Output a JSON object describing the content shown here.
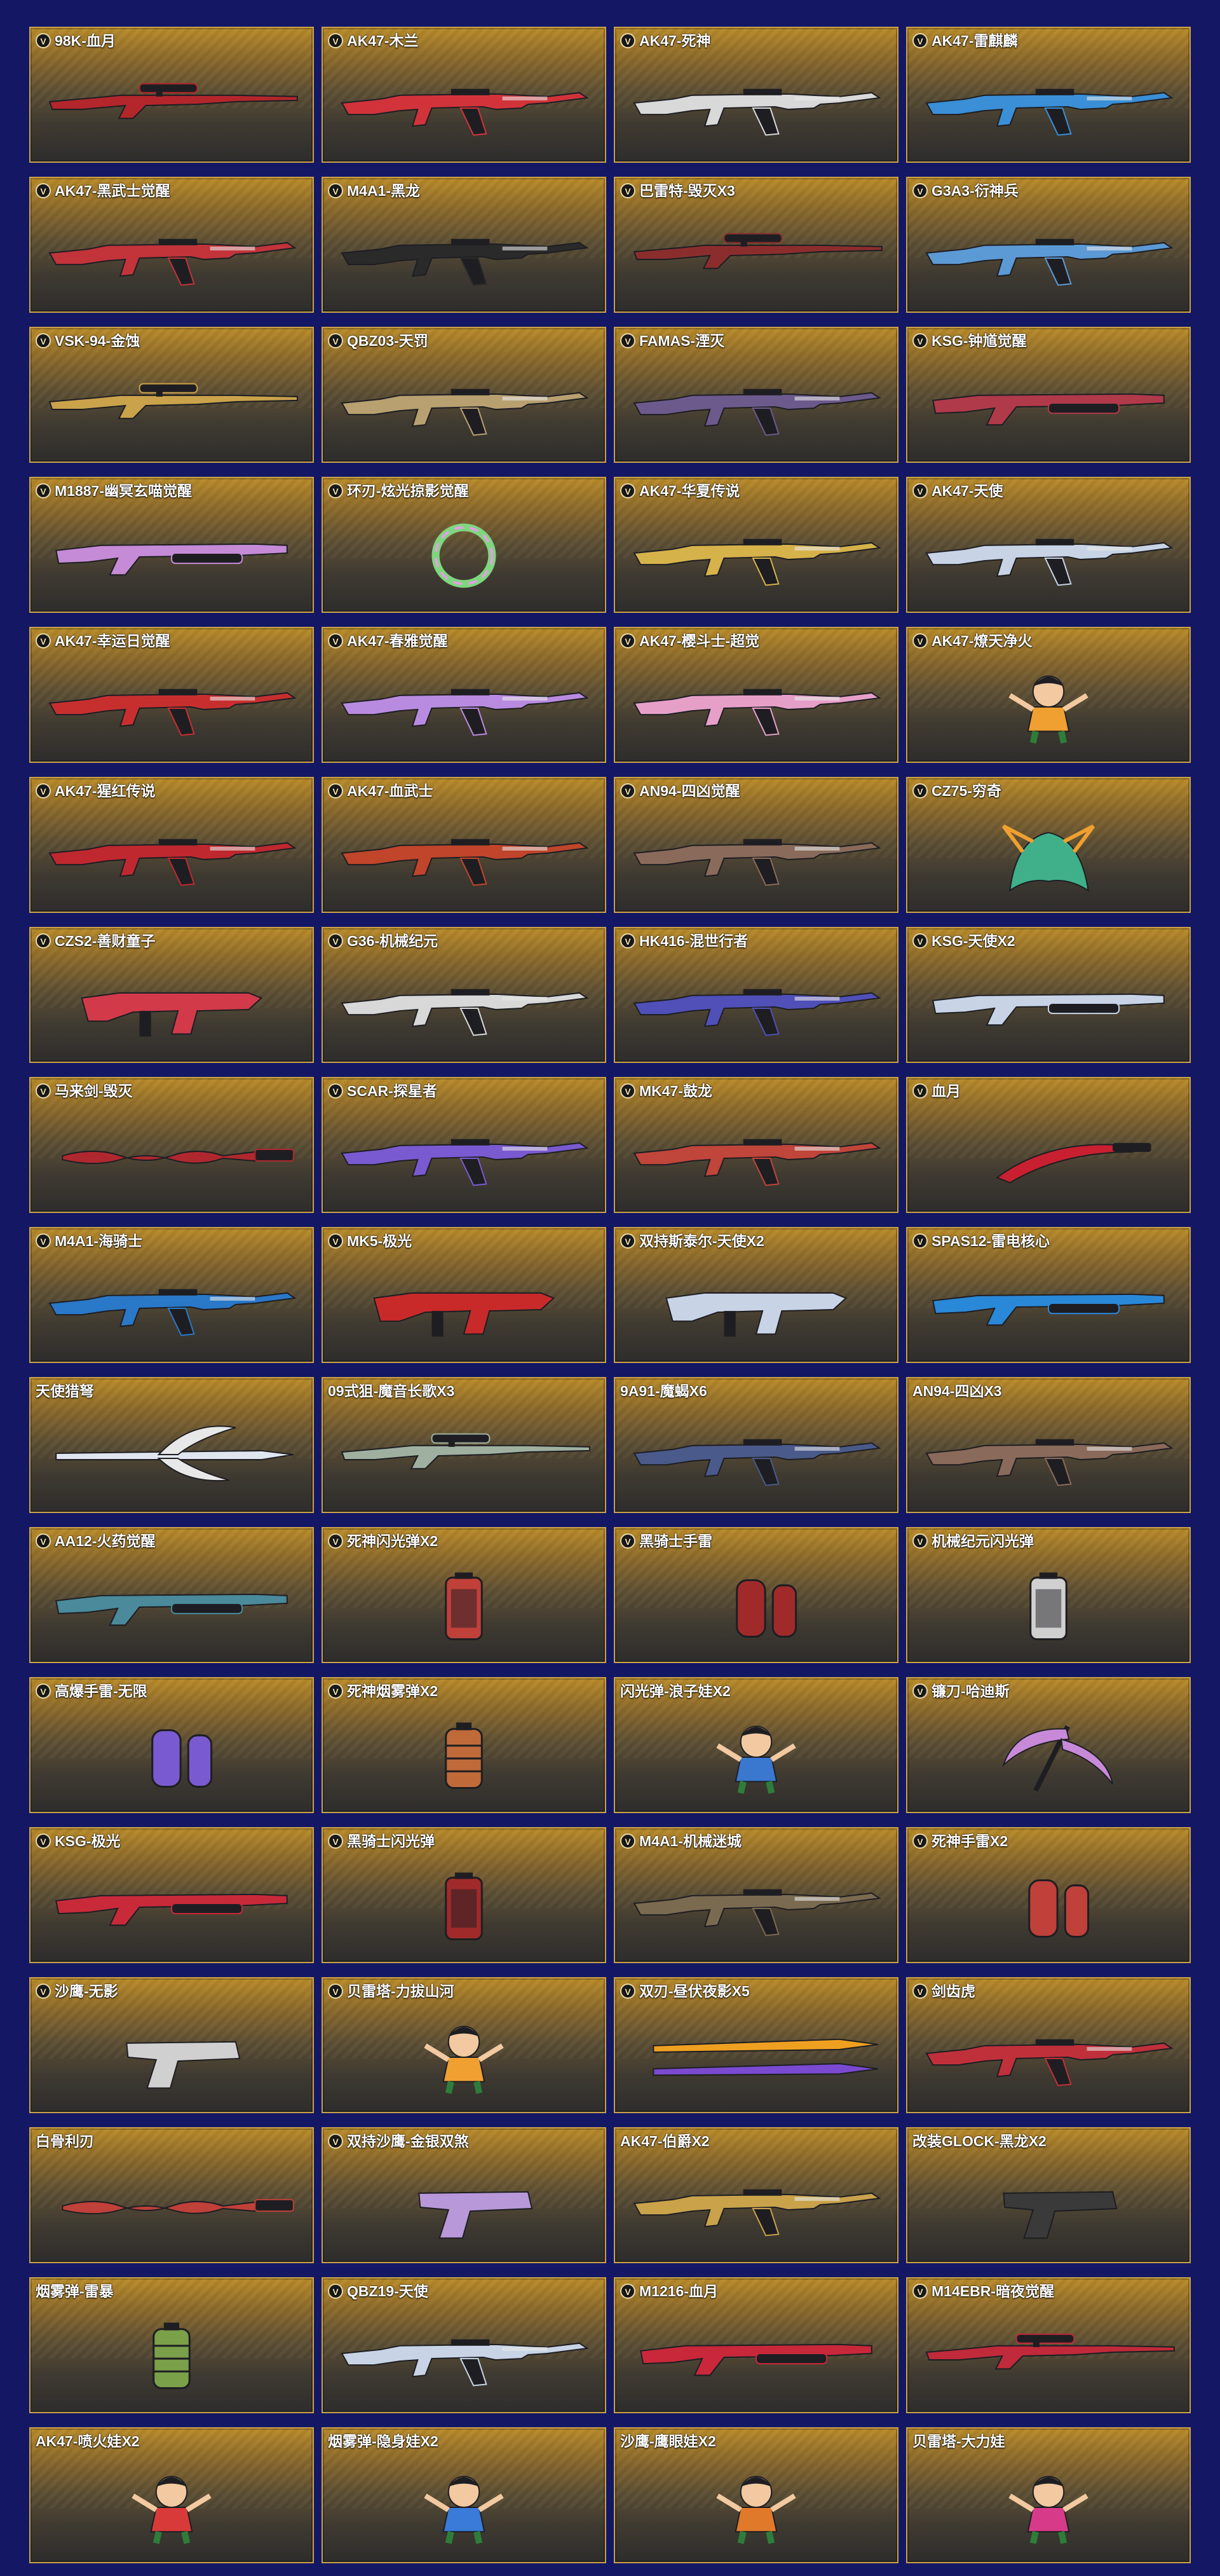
{
  "page": {
    "background": "#131764",
    "card_border": "#c9a24a"
  },
  "items": [
    {
      "label": "98K-血月",
      "vip": true,
      "icon": "sniper-rifle-icon",
      "color": "#b3262b"
    },
    {
      "label": "AK47-木兰",
      "vip": true,
      "icon": "assault-rifle-icon",
      "color": "#d2333a"
    },
    {
      "label": "AK47-死神",
      "vip": true,
      "icon": "assault-rifle-icon",
      "color": "#d9d9d9"
    },
    {
      "label": "AK47-雷麒麟",
      "vip": true,
      "icon": "assault-rifle-icon",
      "color": "#3a8fd6"
    },
    {
      "label": "AK47-黑武士觉醒",
      "vip": true,
      "icon": "assault-rifle-icon",
      "color": "#c2333a"
    },
    {
      "label": "M4A1-黑龙",
      "vip": true,
      "icon": "assault-rifle-icon",
      "color": "#2a2a2a"
    },
    {
      "label": "巴雷特-毁灭X3",
      "vip": true,
      "icon": "sniper-rifle-icon",
      "color": "#8c2d2d"
    },
    {
      "label": "G3A3-衍神兵",
      "vip": true,
      "icon": "assault-rifle-icon",
      "color": "#5c9ad6"
    },
    {
      "label": "VSK-94-金蚀",
      "vip": true,
      "icon": "sniper-rifle-icon",
      "color": "#c9a24a"
    },
    {
      "label": "QBZ03-天罚",
      "vip": true,
      "icon": "assault-rifle-icon",
      "color": "#b8a070"
    },
    {
      "label": "FAMAS-湮灭",
      "vip": true,
      "icon": "assault-rifle-icon",
      "color": "#6d5a8c"
    },
    {
      "label": "KSG-钟馗觉醒",
      "vip": true,
      "icon": "shotgun-icon",
      "color": "#b03a4a"
    },
    {
      "label": "M1887-幽冥玄喵觉醒",
      "vip": true,
      "icon": "shotgun-icon",
      "color": "#c58bd6"
    },
    {
      "label": "环刃-炫光掠影觉醒",
      "vip": true,
      "icon": "ring-blade-icon",
      "color": "#7fd67f"
    },
    {
      "label": "AK47-华夏传说",
      "vip": true,
      "icon": "assault-rifle-icon",
      "color": "#d6b24a"
    },
    {
      "label": "AK47-天使",
      "vip": true,
      "icon": "assault-rifle-icon",
      "color": "#c8d4e6"
    },
    {
      "label": "AK47-幸运日觉醒",
      "vip": true,
      "icon": "assault-rifle-icon",
      "color": "#c72f2f"
    },
    {
      "label": "AK47-春雅觉醒",
      "vip": true,
      "icon": "assault-rifle-icon",
      "color": "#b98be0"
    },
    {
      "label": "AK47-樱斗士-超觉",
      "vip": true,
      "icon": "assault-rifle-icon",
      "color": "#e6a0c8"
    },
    {
      "label": "AK47-燎天净火",
      "vip": true,
      "icon": "character-icon",
      "color": "#f0a030"
    },
    {
      "label": "AK47-猩红传说",
      "vip": true,
      "icon": "assault-rifle-icon",
      "color": "#c0282f"
    },
    {
      "label": "AK47-血武士",
      "vip": true,
      "icon": "assault-rifle-icon",
      "color": "#c0452a"
    },
    {
      "label": "AN94-四凶觉醒",
      "vip": true,
      "icon": "assault-rifle-icon",
      "color": "#8a6a5a"
    },
    {
      "label": "CZ75-穷奇",
      "vip": true,
      "icon": "beast-icon",
      "color": "#3fb08a"
    },
    {
      "label": "CZS2-善财童子",
      "vip": true,
      "icon": "smg-icon",
      "color": "#d23a4a"
    },
    {
      "label": "G36-机械纪元",
      "vip": true,
      "icon": "assault-rifle-icon",
      "color": "#d8d8d8"
    },
    {
      "label": "HK416-混世行者",
      "vip": true,
      "icon": "assault-rifle-icon",
      "color": "#5050b8"
    },
    {
      "label": "KSG-天使X2",
      "vip": true,
      "icon": "shotgun-icon",
      "color": "#c8d4e6"
    },
    {
      "label": "马来剑-毁灭",
      "vip": true,
      "icon": "sword-icon",
      "color": "#b0282f"
    },
    {
      "label": "SCAR-探星者",
      "vip": true,
      "icon": "assault-rifle-icon",
      "color": "#7a5ad0"
    },
    {
      "label": "MK47-鼓龙",
      "vip": true,
      "icon": "assault-rifle-icon",
      "color": "#c0453a"
    },
    {
      "label": "血月",
      "vip": true,
      "icon": "blade-icon",
      "color": "#c82030"
    },
    {
      "label": "M4A1-海骑士",
      "vip": true,
      "icon": "assault-rifle-icon",
      "color": "#2a78c8"
    },
    {
      "label": "MK5-极光",
      "vip": true,
      "icon": "smg-icon",
      "color": "#c82a2a"
    },
    {
      "label": "双持斯泰尔-天使X2",
      "vip": true,
      "icon": "smg-icon",
      "color": "#c8d4e6"
    },
    {
      "label": "SPAS12-雷电核心",
      "vip": true,
      "icon": "shotgun-icon",
      "color": "#2a88d8"
    },
    {
      "label": "天使猎弩",
      "vip": false,
      "icon": "crossbow-icon",
      "color": "#e0e6f0"
    },
    {
      "label": "09式狙-魔音长歌X3",
      "vip": false,
      "icon": "sniper-rifle-icon",
      "color": "#a0b0a0"
    },
    {
      "label": "9A91-魔蝎X6",
      "vip": false,
      "icon": "assault-rifle-icon",
      "color": "#4a5a8a"
    },
    {
      "label": "AN94-四凶X3",
      "vip": false,
      "icon": "assault-rifle-icon",
      "color": "#8a6a5a"
    },
    {
      "label": "AA12-火药觉醒",
      "vip": true,
      "icon": "shotgun-icon",
      "color": "#4a8a9a"
    },
    {
      "label": "死神闪光弹X2",
      "vip": true,
      "icon": "flashbang-icon",
      "color": "#c0403a"
    },
    {
      "label": "黑骑士手雷",
      "vip": true,
      "icon": "grenade-icon",
      "color": "#a02a2a"
    },
    {
      "label": "机械纪元闪光弹",
      "vip": true,
      "icon": "flashbang-icon",
      "color": "#d0d0d0"
    },
    {
      "label": "高爆手雷-无限",
      "vip": true,
      "icon": "grenade-icon",
      "color": "#7a5ad0"
    },
    {
      "label": "死神烟雾弹X2",
      "vip": true,
      "icon": "smoke-grenade-icon",
      "color": "#c06a3a"
    },
    {
      "label": "闪光弹-浪子娃X2",
      "vip": false,
      "icon": "character-icon",
      "color": "#3a78d0"
    },
    {
      "label": "镰刀-哈迪斯",
      "vip": true,
      "icon": "scythe-icon",
      "color": "#c88ad8"
    },
    {
      "label": "KSG-极光",
      "vip": true,
      "icon": "shotgun-icon",
      "color": "#c82a3a"
    },
    {
      "label": "黑骑士闪光弹",
      "vip": true,
      "icon": "flashbang-icon",
      "color": "#a02a2a"
    },
    {
      "label": "M4A1-机械迷城",
      "vip": true,
      "icon": "assault-rifle-icon",
      "color": "#7a6a50"
    },
    {
      "label": "死神手雷X2",
      "vip": true,
      "icon": "grenade-icon",
      "color": "#c0403a"
    },
    {
      "label": "沙鹰-无影",
      "vip": true,
      "icon": "pistol-icon",
      "color": "#d0d0d0"
    },
    {
      "label": "贝雷塔-力拔山河",
      "vip": true,
      "icon": "character-icon",
      "color": "#f0a030"
    },
    {
      "label": "双刃-昼伏夜影X5",
      "vip": true,
      "icon": "twin-blade-icon",
      "color": "#f0a020"
    },
    {
      "label": "剑齿虎",
      "vip": true,
      "icon": "assault-rifle-icon",
      "color": "#c0303a"
    },
    {
      "label": "白骨利刃",
      "vip": false,
      "icon": "sword-icon",
      "color": "#c0403a"
    },
    {
      "label": "双持沙鹰-金银双煞",
      "vip": true,
      "icon": "pistol-icon",
      "color": "#b898d8"
    },
    {
      "label": "AK47-伯爵X2",
      "vip": false,
      "icon": "assault-rifle-icon",
      "color": "#c9a24a"
    },
    {
      "label": "改装GLOCK-黑龙X2",
      "vip": false,
      "icon": "pistol-icon",
      "color": "#3a3a3a"
    },
    {
      "label": "烟雾弹-雷暴",
      "vip": false,
      "icon": "smoke-grenade-icon",
      "color": "#7aa04a"
    },
    {
      "label": "QBZ19-天使",
      "vip": true,
      "icon": "assault-rifle-icon",
      "color": "#c8d4e6"
    },
    {
      "label": "M1216-血月",
      "vip": true,
      "icon": "shotgun-icon",
      "color": "#c8283a"
    },
    {
      "label": "M14EBR-暗夜觉醒",
      "vip": true,
      "icon": "sniper-rifle-icon",
      "color": "#c02a3a"
    },
    {
      "label": "AK47-喷火娃X2",
      "vip": false,
      "icon": "character-icon",
      "color": "#d83a3a"
    },
    {
      "label": "烟雾弹-隐身娃X2",
      "vip": false,
      "icon": "character-icon",
      "color": "#3a7ad8"
    },
    {
      "label": "沙鹰-鹰眼娃X2",
      "vip": false,
      "icon": "character-icon",
      "color": "#e07a2a"
    },
    {
      "label": "贝雷塔-大力娃",
      "vip": false,
      "icon": "character-icon",
      "color": "#d83a8a"
    }
  ]
}
